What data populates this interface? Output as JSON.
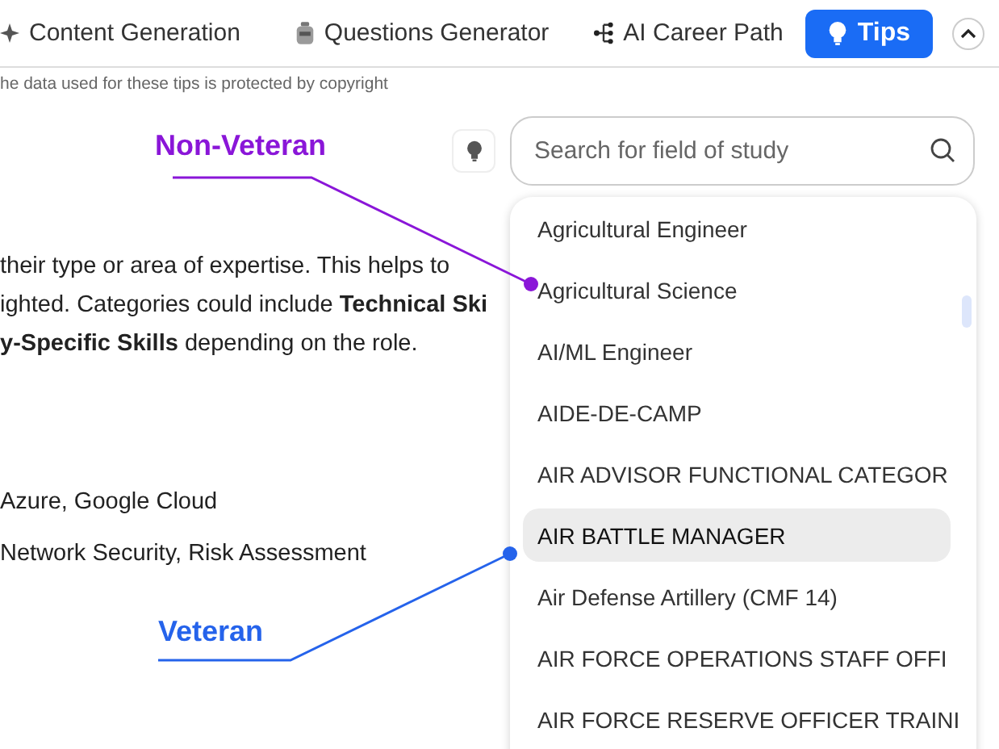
{
  "nav": {
    "items": [
      {
        "label": "Content Generation",
        "selected": false
      },
      {
        "label": "Questions Generator",
        "selected": false
      },
      {
        "label": "AI Career Path",
        "selected": false
      },
      {
        "label": "Tips",
        "selected": true
      }
    ]
  },
  "notice": "he data used for these tips is protected by copyright",
  "content": {
    "lines": [
      "their type or area of expertise. This helps to",
      "ighted. Categories could include **Technical Ski**",
      "**y-Specific Skills** depending on the role.",
      "Azure, Google Cloud",
      "Network Security, Risk Assessment"
    ]
  },
  "search": {
    "placeholder": "Search for field of study"
  },
  "dropdown": {
    "items": [
      {
        "label": "Agricultural Engineer",
        "selected": false
      },
      {
        "label": "Agricultural Science",
        "selected": false
      },
      {
        "label": "AI/ML Engineer",
        "selected": false
      },
      {
        "label": "AIDE-DE-CAMP",
        "selected": false
      },
      {
        "label": "AIR ADVISOR FUNCTIONAL CATEGOR",
        "selected": false
      },
      {
        "label": "AIR BATTLE MANAGER",
        "selected": true
      },
      {
        "label": "Air Defense Artillery (CMF 14)",
        "selected": false
      },
      {
        "label": "AIR FORCE OPERATIONS STAFF OFFI",
        "selected": false
      },
      {
        "label": "AIR FORCE RESERVE OFFICER TRAINI",
        "selected": false
      }
    ]
  },
  "annotations": [
    {
      "label": "Non-Veteran",
      "color": "#8a16d8"
    },
    {
      "label": "Veteran",
      "color": "#2563eb"
    }
  ]
}
